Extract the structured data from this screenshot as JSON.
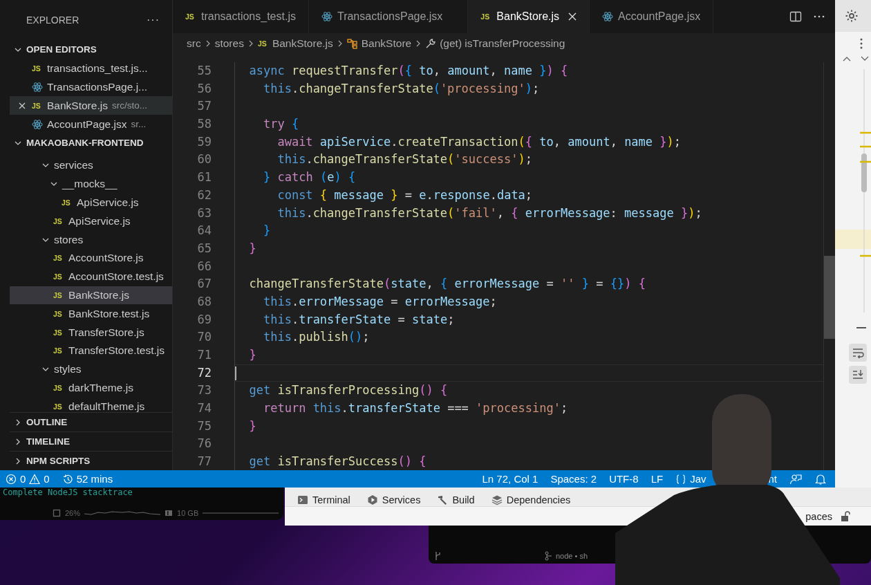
{
  "explorer": {
    "title": "EXPLORER",
    "more": "···"
  },
  "open_editors": {
    "title": "OPEN EDITORS",
    "expanded": true,
    "items": [
      {
        "name": "transactions_test.js...",
        "kind": "js",
        "icon_text": "JS",
        "selected": false,
        "closable": false
      },
      {
        "name": "TransactionsPage.j...",
        "kind": "react",
        "selected": false,
        "closable": false
      },
      {
        "name": "BankStore.js",
        "path": "src/sto...",
        "kind": "js",
        "icon_text": "JS",
        "selected": true,
        "closable": true
      },
      {
        "name": "AccountPage.jsx",
        "path": "sr...",
        "kind": "react",
        "selected": false,
        "closable": false
      }
    ]
  },
  "project": {
    "title": "MAKAOBANK-FRONTEND",
    "expanded": true,
    "tree": [
      {
        "name": "services",
        "kind": "folder",
        "expanded": true,
        "selected": false,
        "children": [
          {
            "name": "__mocks__",
            "kind": "folder",
            "expanded": true,
            "selected": false,
            "children": [
              {
                "name": "ApiService.js",
                "kind": "js",
                "icon_text": "JS",
                "selected": false
              }
            ]
          },
          {
            "name": "ApiService.js",
            "kind": "js",
            "icon_text": "JS",
            "selected": false
          }
        ]
      },
      {
        "name": "stores",
        "kind": "folder",
        "expanded": true,
        "selected": false,
        "children": [
          {
            "name": "AccountStore.js",
            "kind": "js",
            "icon_text": "JS",
            "selected": false
          },
          {
            "name": "AccountStore.test.js",
            "kind": "js",
            "icon_text": "JS",
            "selected": false
          },
          {
            "name": "BankStore.js",
            "kind": "js",
            "icon_text": "JS",
            "selected": true
          },
          {
            "name": "BankStore.test.js",
            "kind": "js",
            "icon_text": "JS",
            "selected": false
          },
          {
            "name": "TransferStore.js",
            "kind": "js",
            "icon_text": "JS",
            "selected": false
          },
          {
            "name": "TransferStore.test.js",
            "kind": "js",
            "icon_text": "JS",
            "selected": false
          }
        ]
      },
      {
        "name": "styles",
        "kind": "folder",
        "expanded": true,
        "selected": false,
        "children": [
          {
            "name": "darkTheme.js",
            "kind": "js",
            "icon_text": "JS",
            "selected": false
          },
          {
            "name": "defaultTheme.js",
            "kind": "js",
            "icon_text": "JS",
            "selected": false
          }
        ]
      }
    ]
  },
  "panels": [
    {
      "title": "OUTLINE",
      "expanded": false
    },
    {
      "title": "TIMELINE",
      "expanded": false
    },
    {
      "title": "NPM SCRIPTS",
      "expanded": false
    }
  ],
  "tabs": [
    {
      "label": "transactions_test.js",
      "kind": "js",
      "icon_text": "JS",
      "selected": false
    },
    {
      "label": "TransactionsPage.jsx",
      "kind": "react",
      "selected": false
    },
    {
      "label": "BankStore.js",
      "kind": "js",
      "icon_text": "JS",
      "selected": true
    },
    {
      "label": "AccountPage.jsx",
      "kind": "react",
      "selected": false
    }
  ],
  "breadcrumbs": [
    {
      "label": "src",
      "kind": "folder"
    },
    {
      "label": "stores",
      "kind": "folder"
    },
    {
      "label": "BankStore.js",
      "kind": "js",
      "icon_text": "JS"
    },
    {
      "label": "BankStore",
      "kind": "class"
    },
    {
      "label": "(get) isTransferProcessing",
      "kind": "property"
    }
  ],
  "code": [
    {
      "number": "55",
      "current": false,
      "text": "  async requestTransfer({ to, amount, name }) {"
    },
    {
      "number": "56",
      "current": false,
      "text": "    this.changeTransferState('processing');"
    },
    {
      "number": "57",
      "current": false
    },
    {
      "number": "58",
      "current": false,
      "text": "    try {"
    },
    {
      "number": "59",
      "current": false,
      "text": "      await apiService.createTransaction({ to, amount, name });"
    },
    {
      "number": "60",
      "current": false,
      "text": "      this.changeTransferState('success');"
    },
    {
      "number": "61",
      "current": false,
      "text": "    } catch (e) {"
    },
    {
      "number": "62",
      "current": false,
      "text": "      const { message } = e.response.data;"
    },
    {
      "number": "63",
      "current": false,
      "text": "      this.changeTransferState('fail', { errorMessage: message });"
    },
    {
      "number": "64",
      "current": false,
      "text": "    }"
    },
    {
      "number": "65",
      "current": false,
      "text": "  }"
    },
    {
      "number": "66",
      "current": false
    },
    {
      "number": "67",
      "current": false,
      "text": "  changeTransferState(state, { errorMessage = '' } = {}) {"
    },
    {
      "number": "68",
      "current": false,
      "text": "    this.errorMessage = errorMessage;"
    },
    {
      "number": "69",
      "current": false,
      "text": "    this.transferState = state;"
    },
    {
      "number": "70",
      "current": false,
      "text": "    this.publish();"
    },
    {
      "number": "71",
      "current": false,
      "text": "  }"
    },
    {
      "number": "72",
      "current": true
    },
    {
      "number": "73",
      "current": false,
      "text": "  get isTransferProcessing() {"
    },
    {
      "number": "74",
      "current": false,
      "text": "    return this.transferState === 'processing';"
    },
    {
      "number": "75",
      "current": false,
      "text": "  }"
    },
    {
      "number": "76",
      "current": false
    },
    {
      "number": "77",
      "current": false,
      "text": "  get isTransferSuccess() {"
    }
  ],
  "status_bar": {
    "errors": "0",
    "warnings": "0",
    "time": "52 mins",
    "position": "Ln 72, Col 1",
    "spaces": "Spaces: 2",
    "encoding": "UTF-8",
    "eol": "LF",
    "language": "Jav",
    "language_tail": "nt"
  },
  "background_terminal": {
    "text": "Complete NodeJS stacktrace",
    "cpu": "26%",
    "memory": "10 GB"
  },
  "tool_tabs": [
    {
      "label": "Terminal",
      "kind": "terminal"
    },
    {
      "label": "Services",
      "kind": "services"
    },
    {
      "label": "Build",
      "kind": "build"
    },
    {
      "label": "Dependencies",
      "kind": "layers"
    }
  ],
  "tool_status": "paces",
  "terminal_window": {
    "title": "node • sh"
  }
}
